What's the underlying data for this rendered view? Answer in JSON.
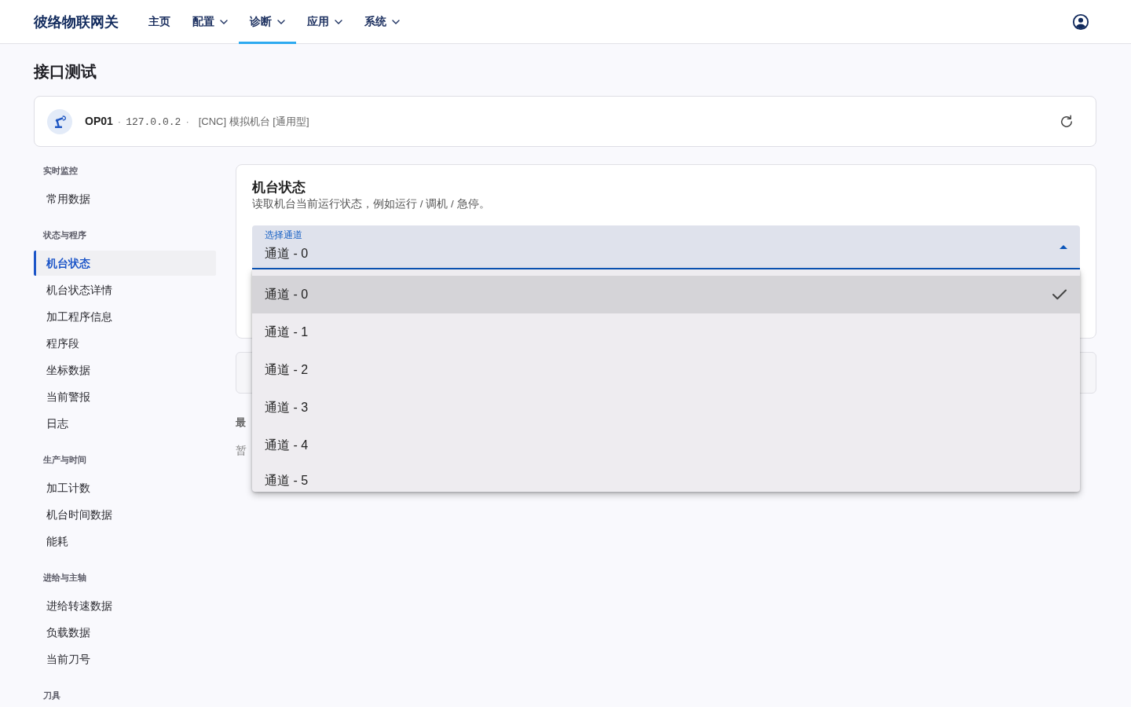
{
  "nav": {
    "brand": "彼络物联网关",
    "items": [
      {
        "label": "主页",
        "dropdown": false,
        "selected": false
      },
      {
        "label": "配置",
        "dropdown": true,
        "selected": false
      },
      {
        "label": "诊断",
        "dropdown": true,
        "selected": true
      },
      {
        "label": "应用",
        "dropdown": true,
        "selected": false
      },
      {
        "label": "系统",
        "dropdown": true,
        "selected": false
      }
    ]
  },
  "page": {
    "title": "接口测试"
  },
  "device": {
    "parts": [
      {
        "kind": "name",
        "text": "OP01"
      },
      {
        "kind": "separator",
        "text": "·"
      },
      {
        "kind": "address",
        "text": "127.0.0.2"
      },
      {
        "kind": "separator",
        "text": "·"
      },
      {
        "kind": "description",
        "text": "[CNC] 模拟机台 [通用型]"
      }
    ]
  },
  "sidebar": {
    "sections": [
      {
        "heading": "实时监控",
        "items": [
          {
            "label": "常用数据",
            "selected": false
          }
        ]
      },
      {
        "heading": "状态与程序",
        "items": [
          {
            "label": "机台状态",
            "selected": true
          },
          {
            "label": "机台状态详情",
            "selected": false
          },
          {
            "label": "加工程序信息",
            "selected": false
          },
          {
            "label": "程序段",
            "selected": false
          },
          {
            "label": "坐标数据",
            "selected": false
          },
          {
            "label": "当前警报",
            "selected": false
          },
          {
            "label": "日志",
            "selected": false
          }
        ]
      },
      {
        "heading": "生产与时间",
        "items": [
          {
            "label": "加工计数",
            "selected": false
          },
          {
            "label": "机台时间数据",
            "selected": false
          },
          {
            "label": "能耗",
            "selected": false
          }
        ]
      },
      {
        "heading": "进给与主轴",
        "items": [
          {
            "label": "进给转速数据",
            "selected": false
          },
          {
            "label": "负载数据",
            "selected": false
          },
          {
            "label": "当前刀号",
            "selected": false
          }
        ]
      },
      {
        "heading": "刀具"
      }
    ]
  },
  "panel": {
    "title": "机台状态",
    "description": "读取机台当前运行状态，例如运行 / 调机 / 急停。",
    "select": {
      "label": "选择通道",
      "value": "通道 - 0",
      "expanded": true,
      "options": [
        {
          "label": "通道 - 0",
          "selected": true
        },
        {
          "label": "通道 - 1",
          "selected": false
        },
        {
          "label": "通道 - 2",
          "selected": false
        },
        {
          "label": "通道 - 3",
          "selected": false
        },
        {
          "label": "通道 - 4",
          "selected": false
        },
        {
          "label": "通道 - 5",
          "selected": false
        }
      ]
    }
  },
  "section_below": {
    "heading": "最",
    "text": "暂"
  }
}
